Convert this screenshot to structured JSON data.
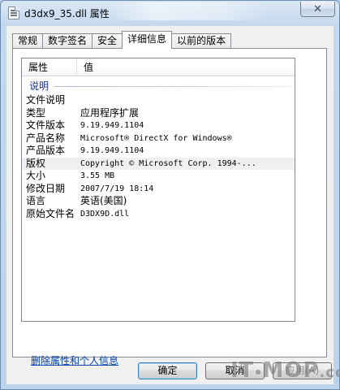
{
  "window": {
    "title": "d3dx9_35.dll 属性",
    "close_glyph": "✕"
  },
  "tabs": [
    {
      "label": "常规",
      "active": false
    },
    {
      "label": "数字签名",
      "active": false
    },
    {
      "label": "安全",
      "active": false
    },
    {
      "label": "详细信息",
      "active": true
    },
    {
      "label": "以前的版本",
      "active": false
    }
  ],
  "details": {
    "columns": {
      "property": "属性",
      "value": "值"
    },
    "group": "说明",
    "rows": [
      {
        "key": "文件说明",
        "value": ""
      },
      {
        "key": "类型",
        "value": "应用程序扩展"
      },
      {
        "key": "文件版本",
        "value": "9.19.949.1104"
      },
      {
        "key": "产品名称",
        "value": "Microsoft® DirectX for Windows®"
      },
      {
        "key": "产品版本",
        "value": "9.19.949.1104"
      },
      {
        "key": "版权",
        "value": "Copyright © Microsoft Corp. 1994-..."
      },
      {
        "key": "大小",
        "value": "3.55 MB"
      },
      {
        "key": "修改日期",
        "value": "2007/7/19 18:14"
      },
      {
        "key": "语言",
        "value": "英语(美国)"
      },
      {
        "key": "原始文件名",
        "value": "D3DX9D.dll"
      }
    ]
  },
  "remove_link": "删除属性和个人信息",
  "buttons": {
    "ok": "确定",
    "cancel": "取消",
    "apply": "应用(A)"
  },
  "watermark": {
    "text_left": "IT",
    "text_right": "MOP",
    "tld": ".com"
  },
  "colors": {
    "link": "#0645ad",
    "group_label": "#1e3287",
    "window_frame": "#b9d1ea"
  }
}
